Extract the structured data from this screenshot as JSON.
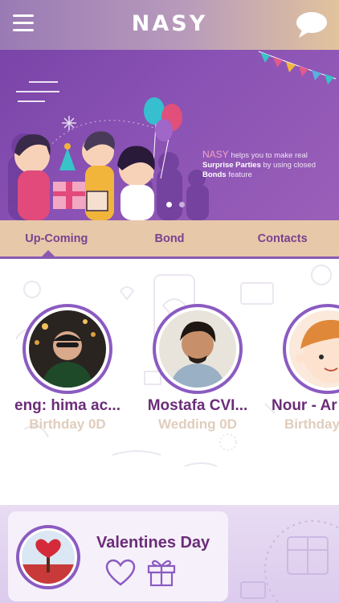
{
  "header": {
    "logo": "NASY",
    "menu_icon": "hamburger-menu-icon",
    "chat_icon": "chat-bubble-icon"
  },
  "banner": {
    "brand": "NASY",
    "text_1": " helps you to make real ",
    "highlight_1": "Surprise Parties",
    "text_2": " by using closed ",
    "highlight_2": "Bonds",
    "text_3": " feature",
    "active_slide": 1,
    "slide_count": 2
  },
  "tabs": [
    {
      "label": "Up-Coming",
      "active": true
    },
    {
      "label": "Bond",
      "active": false
    },
    {
      "label": "Contacts",
      "active": false
    }
  ],
  "upcoming": [
    {
      "name": "eng: hima ac...",
      "event": "Birthday 0D"
    },
    {
      "name": "Mostafa CVI...",
      "event": "Wedding 0D"
    },
    {
      "name": "Nour - Ar",
      "event": "Birthday"
    }
  ],
  "featured": {
    "title": "Valentines Day",
    "heart_icon": "heart-outline-icon",
    "gift_icon": "gift-outline-icon"
  },
  "colors": {
    "accent_purple": "#8b5bc1",
    "text_purple": "#6b2d78",
    "tab_bar": "#e7c8a9",
    "event_text": "#e0cdbd"
  }
}
